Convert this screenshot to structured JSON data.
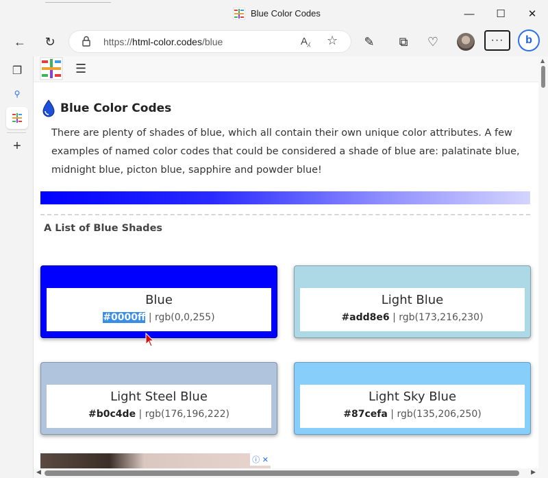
{
  "window": {
    "title": "Blue Color Codes"
  },
  "toolbar": {
    "url_prefix": "https://",
    "url_domain": "html-color.codes",
    "url_path": "/blue"
  },
  "page": {
    "title": "Blue Color Codes",
    "intro": "There are plenty of shades of blue, which all contain their own unique color attributes. A few examples of named color codes that could be considered a shade of blue are: palatinate blue, midnight blue, picton blue, sapphire and powder blue!",
    "list_title": "A List of Blue Shades",
    "cards": [
      {
        "name": "Blue",
        "hex": "#0000ff",
        "sep": " | ",
        "rgb": "rgb(0,0,255)",
        "color": "#0000ff"
      },
      {
        "name": "Light Blue",
        "hex": "#add8e6",
        "sep": " | ",
        "rgb": "rgb(173,216,230)",
        "color": "#add8e6"
      },
      {
        "name": "Light Steel Blue",
        "hex": "#b0c4de",
        "sep": " | ",
        "rgb": "rgb(176,196,222)",
        "color": "#b0c4de"
      },
      {
        "name": "Light Sky Blue",
        "hex": "#87cefa",
        "sep": " | ",
        "rgb": "rgb(135,206,250)",
        "color": "#87cefa"
      }
    ]
  },
  "icons": {
    "min": "minimize-icon",
    "max": "maximize-icon",
    "close": "close-icon",
    "back": "back-arrow-icon",
    "refresh": "refresh-icon",
    "lock": "lock-icon",
    "read_aloud": "read-aloud-icon",
    "favorite": "star-icon",
    "extensions": "puzzle-icon",
    "collections": "collections-icon",
    "health": "heart-pulse-icon",
    "more": "more-icon",
    "bing": "bing-icon",
    "tabs": "tab-actions-icon",
    "search": "search-icon",
    "add": "plus-icon",
    "menu": "hamburger-icon"
  }
}
